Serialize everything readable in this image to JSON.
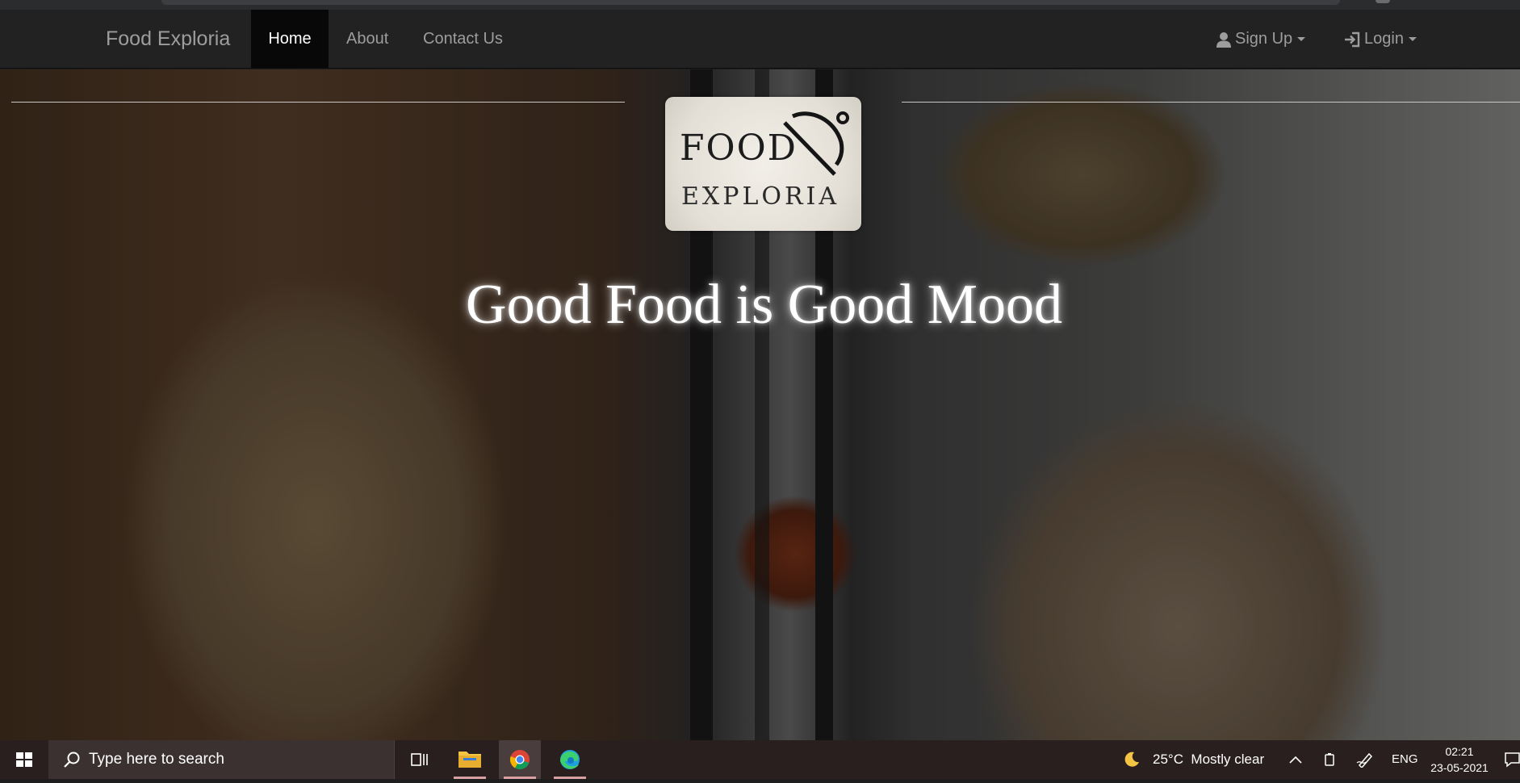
{
  "navbar": {
    "brand": "Food Exploria",
    "items": [
      {
        "label": "Home"
      },
      {
        "label": "About"
      },
      {
        "label": "Contact Us"
      }
    ],
    "signup_label": "Sign Up",
    "login_label": "Login"
  },
  "hero": {
    "logo": {
      "line1": "FOOD",
      "line2": "EXPLORIA"
    },
    "headline": "Good Food is Good Mood"
  },
  "taskbar": {
    "search_placeholder": "Type here to search",
    "weather": "25°C  Mostly clear",
    "language": "ENG",
    "time": "02:21",
    "date": "23-05-2021"
  },
  "colors": {
    "navbar_bg": "#222222",
    "nav_active_bg": "#080808",
    "nav_text": "#9d9d9d",
    "taskbar_bg": "#2a1f1f"
  }
}
